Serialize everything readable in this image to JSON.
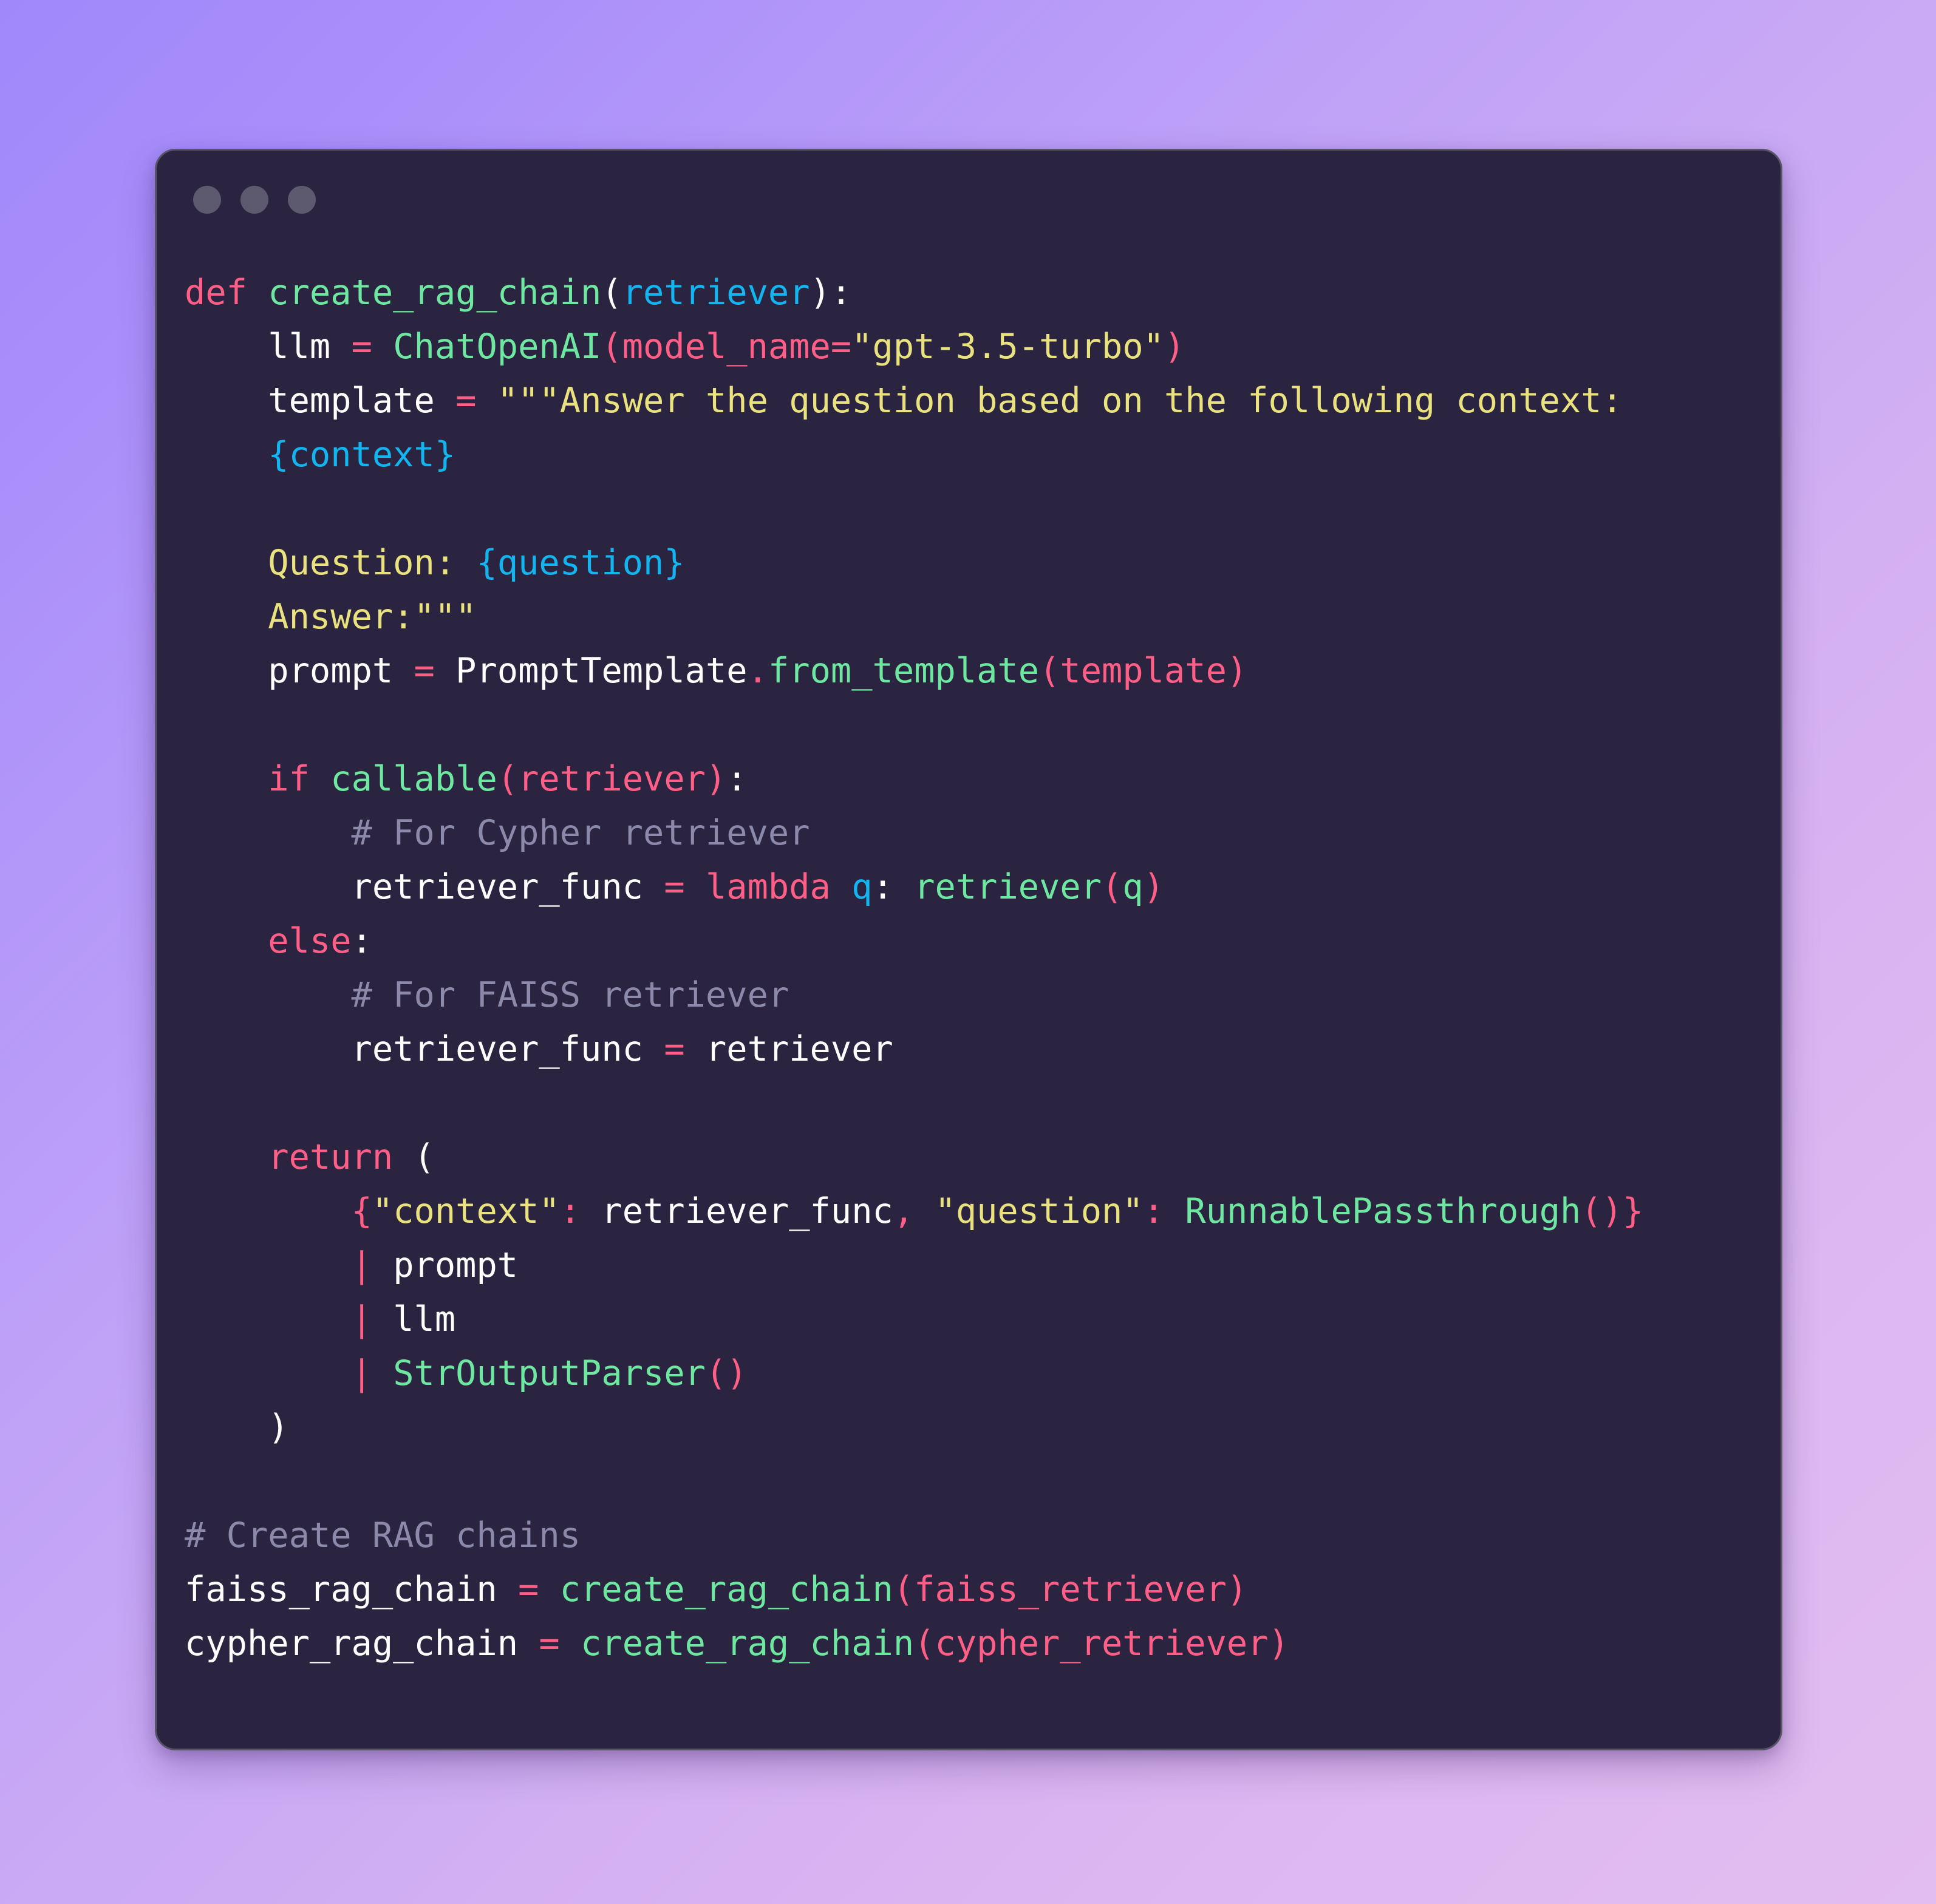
{
  "window": {
    "dots": [
      "traffic-light-1",
      "traffic-light-2",
      "traffic-light-3"
    ],
    "background_top_left": "#a088fb",
    "background_bottom_right": "#e2bdf1",
    "card_background": "#2b2440",
    "card_border": "#575467"
  },
  "theme": {
    "keyword": "#ff5f87",
    "function": "#6ee7a0",
    "parameter": "#12b5f0",
    "string": "#e9e27e",
    "comment": "#8d89ab",
    "plain": "#ffffff"
  },
  "code": {
    "language": "python",
    "full_text": "def create_rag_chain(retriever):\n    llm = ChatOpenAI(model_name=\"gpt-3.5-turbo\")\n    template = \"\"\"Answer the question based on the following context:\n    {context}\n\n    Question: {question}\n    Answer:\"\"\"\n    prompt = PromptTemplate.from_template(template)\n\n    if callable(retriever):\n        # For Cypher retriever\n        retriever_func = lambda q: retriever(q)\n    else:\n        # For FAISS retriever\n        retriever_func = retriever\n\n    return (\n        {\"context\": retriever_func, \"question\": RunnablePassthrough()}\n        | prompt\n        | llm\n        | StrOutputParser()\n    )\n\n# Create RAG chains\nfaiss_rag_chain = create_rag_chain(faiss_retriever)\ncypher_rag_chain = create_rag_chain(cypher_retriever)",
    "lines": [
      "def create_rag_chain(retriever):",
      "    llm = ChatOpenAI(model_name=\"gpt-3.5-turbo\")",
      "    template = \"\"\"Answer the question based on the following context:",
      "    {context}",
      "",
      "    Question: {question}",
      "    Answer:\"\"\"",
      "    prompt = PromptTemplate.from_template(template)",
      "",
      "    if callable(retriever):",
      "        # For Cypher retriever",
      "        retriever_func = lambda q: retriever(q)",
      "    else:",
      "        # For FAISS retriever",
      "        retriever_func = retriever",
      "",
      "    return (",
      "        {\"context\": retriever_func, \"question\": RunnablePassthrough()}",
      "        | prompt",
      "        | llm",
      "        | StrOutputParser()",
      "    )",
      "",
      "# Create RAG chains",
      "faiss_rag_chain = create_rag_chain(faiss_retriever)",
      "cypher_rag_chain = create_rag_chain(cypher_retriever)"
    ]
  }
}
